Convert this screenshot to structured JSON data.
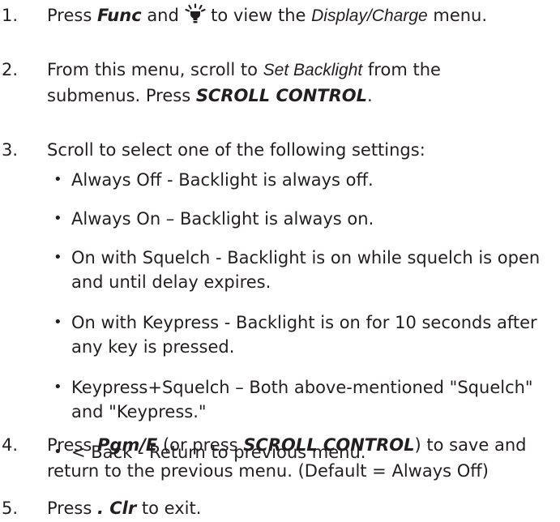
{
  "steps": [
    {
      "number": "1.",
      "parts": [
        "Press ",
        "Func",
        " and ",
        " to view the ",
        "Display/Charge",
        " menu."
      ],
      "icon": "light-bulb-icon"
    },
    {
      "number": "2.",
      "line1": [
        "From this menu, scroll to ",
        "Set Backlight",
        " from the"
      ],
      "line2": [
        "submenus. Press ",
        "SCROLL CONTROL",
        "."
      ]
    },
    {
      "number": "3.",
      "text": "Scroll to select one of the following settings:",
      "options": [
        [
          "Always Off - Backlight is always off."
        ],
        [
          "Always On – Backlight is always on."
        ],
        [
          "On with Squelch - Backlight is on while squelch is open",
          "and until delay expires."
        ],
        [
          "On with Keypress - Backlight is on for 10 seconds after",
          "any key is pressed."
        ],
        [
          "Keypress+Squelch – Both above-mentioned \"Squelch\"",
          "and \"Keypress.\""
        ],
        [
          "< Back - Return to previous menu."
        ]
      ],
      "bullet": "•"
    },
    {
      "number": "4.",
      "line1": [
        "Press ",
        "Pgm/E",
        " (or press ",
        "SCROLL CONTROL",
        ") to save and"
      ],
      "line2": "return to the previous menu. (Default = Always Off)"
    },
    {
      "number": "5.",
      "parts": [
        "Press ",
        ". Clr",
        " to exit."
      ]
    }
  ]
}
